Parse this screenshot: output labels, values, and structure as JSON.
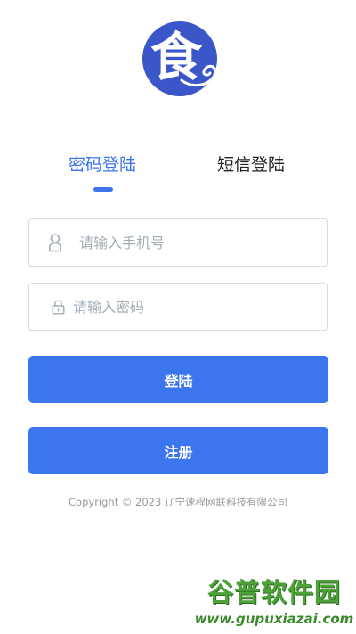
{
  "logo": {
    "glyph": "食",
    "color": "#3a56c8"
  },
  "tabs": [
    {
      "label": "密码登陆",
      "active": true
    },
    {
      "label": "短信登陆",
      "active": false
    }
  ],
  "form": {
    "phone_placeholder": "请输入手机号",
    "password_placeholder": "请输入密码"
  },
  "buttons": {
    "login_label": "登陆",
    "register_label": "注册"
  },
  "footer": {
    "copyright": "Copyright © 2023 辽宁速程网联科技有限公司"
  },
  "watermark": {
    "title": "谷普软件园",
    "url": "www.gupuxiazai.com"
  },
  "colors": {
    "accent": "#3b76ee",
    "icon": "#a3adb8",
    "watermark": "#4da23a"
  },
  "icons": {
    "phone_field": "user-icon",
    "password_field": "lock-icon"
  }
}
